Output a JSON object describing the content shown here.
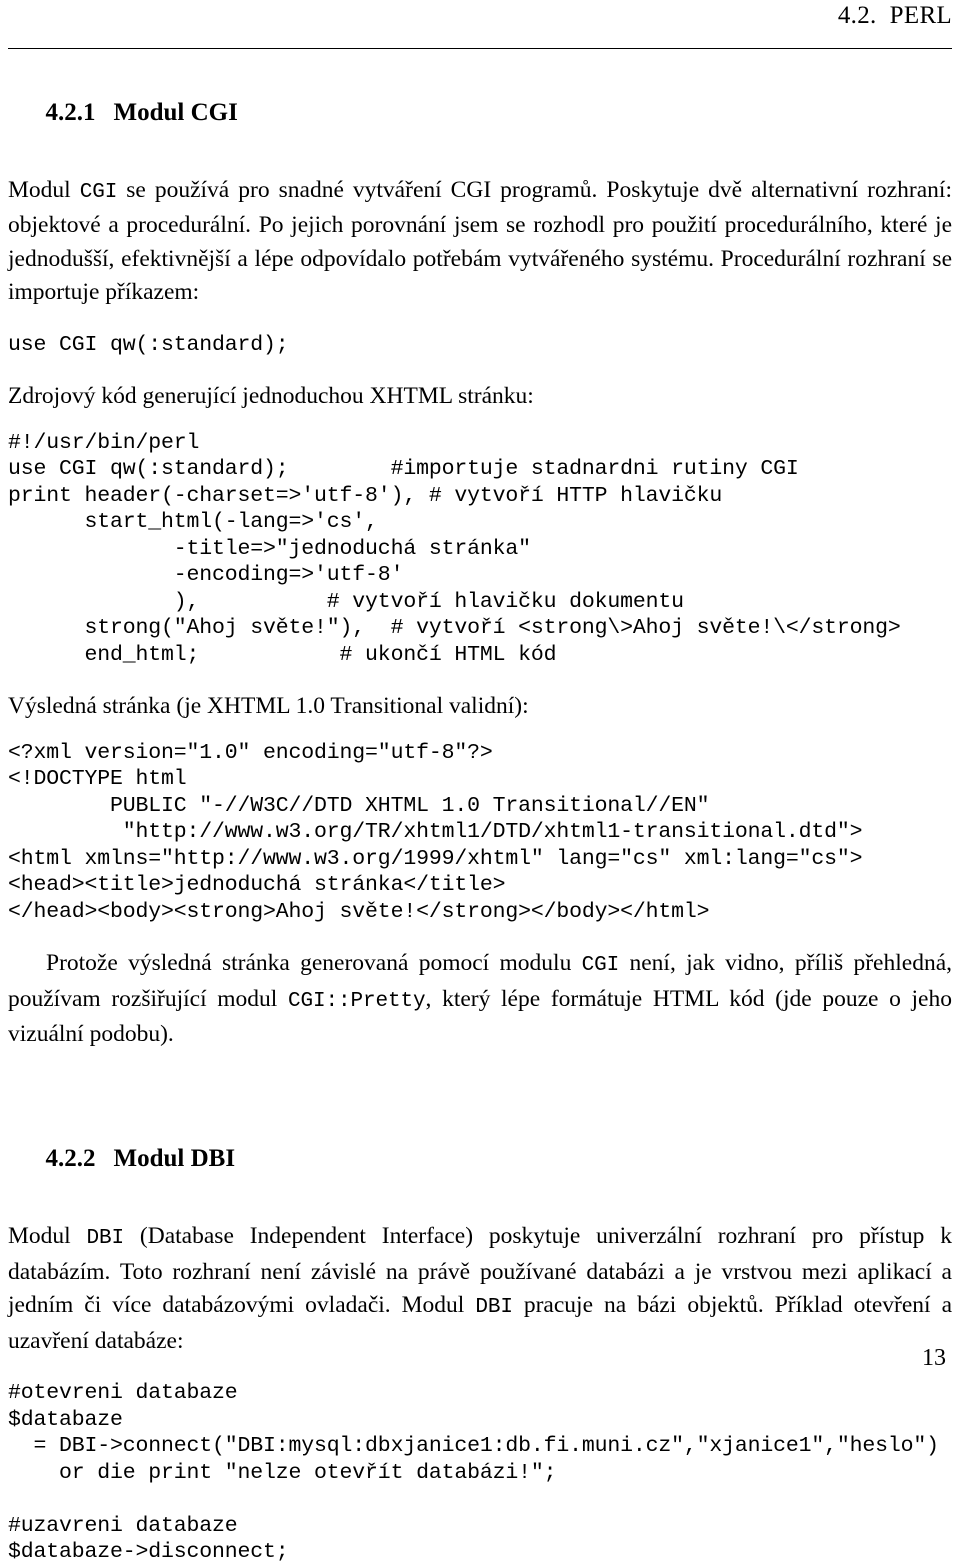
{
  "header": {
    "running_head": "4.2.  PERL"
  },
  "sections": {
    "cgi": {
      "number": "4.2.1",
      "title": "Modul CGI"
    },
    "dbi": {
      "number": "4.2.2",
      "title": "Modul DBI"
    }
  },
  "paragraphs": {
    "cgi_intro_1": "Modul ",
    "cgi_intro_code": "CGI",
    "cgi_intro_2": " se používá pro snadné vytváření CGI programů. Poskytuje dvě alternativní rozhraní: objektové a procedurální. Po jejich porovnání jsem se rozhodl pro použití procedurálního, které je jednodušší, efektivnější a lépe odpovídalo potřebám vytvářeného systému. Procedurální rozhraní se importuje příkazem:",
    "xhtml_source_lead": "Zdrojový kód generující jednoduchou XHTML stránku:",
    "result_lead": "Výsledná stránka (je XHTML 1.0 Transitional validní):",
    "pretty_1": "Protože výsledná stránka generovaná pomocí modulu ",
    "pretty_code_1": "CGI",
    "pretty_2": " není, jak vidno, příliš přehledná, používam rozšiřující modul ",
    "pretty_code_2": "CGI::Pretty",
    "pretty_3": ", který lépe formátuje HTML kód (jde pouze o jeho vizuální podobu).",
    "dbi_1": "Modul ",
    "dbi_code_1": "DBI",
    "dbi_2": " (Database Independent Interface) poskytuje univerzální rozhraní pro přístup k databázím. Toto rozhraní není závislé na právě používané databázi a je vrstvou mezi aplikací a jedním či více databázovými ovladači. Modul ",
    "dbi_code_2": "DBI",
    "dbi_3": " pracuje na bázi objektů. Příklad otevření a uzavření databáze:"
  },
  "code_blocks": {
    "import_statement": "use CGI qw(:standard);",
    "perl_source": "#!/usr/bin/perl\nuse CGI qw(:standard);        #importuje stadnardni rutiny CGI\nprint header(-charset=>'utf-8'), # vytvoří HTTP hlavičku\n      start_html(-lang=>'cs',\n             -title=>\"jednoduchá stránka\"\n             -encoding=>'utf-8'\n             ),          # vytvoří hlavičku dokumentu\n      strong(\"Ahoj světe!\"),  # vytvoří <strong\\>Ahoj světe!\\</strong>\n      end_html;           # ukončí HTML kód",
    "xhtml_output": "<?xml version=\"1.0\" encoding=\"utf-8\"?>\n<!DOCTYPE html\n        PUBLIC \"-//W3C//DTD XHTML 1.0 Transitional//EN\"\n         \"http://www.w3.org/TR/xhtml1/DTD/xhtml1-transitional.dtd\">\n<html xmlns=\"http://www.w3.org/1999/xhtml\" lang=\"cs\" xml:lang=\"cs\">\n<head><title>jednoduchá stránka</title>\n</head><body><strong>Ahoj světe!</strong></body></html>",
    "dbi_example": "#otevreni databaze\n$databaze\n  = DBI->connect(\"DBI:mysql:dbxjanice1:db.fi.muni.cz\",\"xjanice1\",\"heslo\")\n    or die print \"nelze otevřít databázi!\";\n\n#uzavreni databaze\n$databaze->disconnect;"
  },
  "footer": {
    "page_number": "13"
  },
  "colors": {
    "text": "#000000",
    "background": "#ffffff"
  }
}
